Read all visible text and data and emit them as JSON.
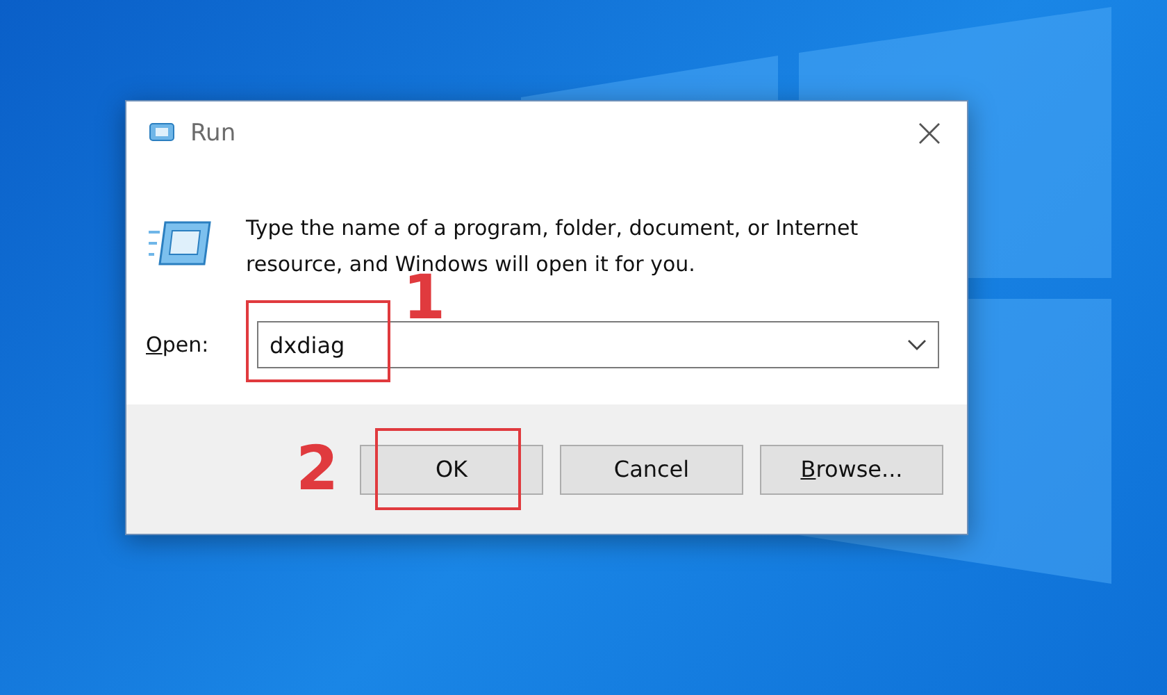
{
  "dialog": {
    "title": "Run",
    "description": "Type the name of a program, folder, document, or Internet resource, and Windows will open it for you.",
    "open_label": {
      "mnemonic": "O",
      "rest": "pen:"
    },
    "open_value": "dxdiag",
    "buttons": [
      {
        "kind": "plain",
        "label": "OK"
      },
      {
        "kind": "plain",
        "label": "Cancel"
      },
      {
        "kind": "mnemonic",
        "mnemonic": "B",
        "label": "rowse..."
      }
    ]
  },
  "annotations": [
    {
      "label": "1"
    },
    {
      "label": "2"
    }
  ]
}
